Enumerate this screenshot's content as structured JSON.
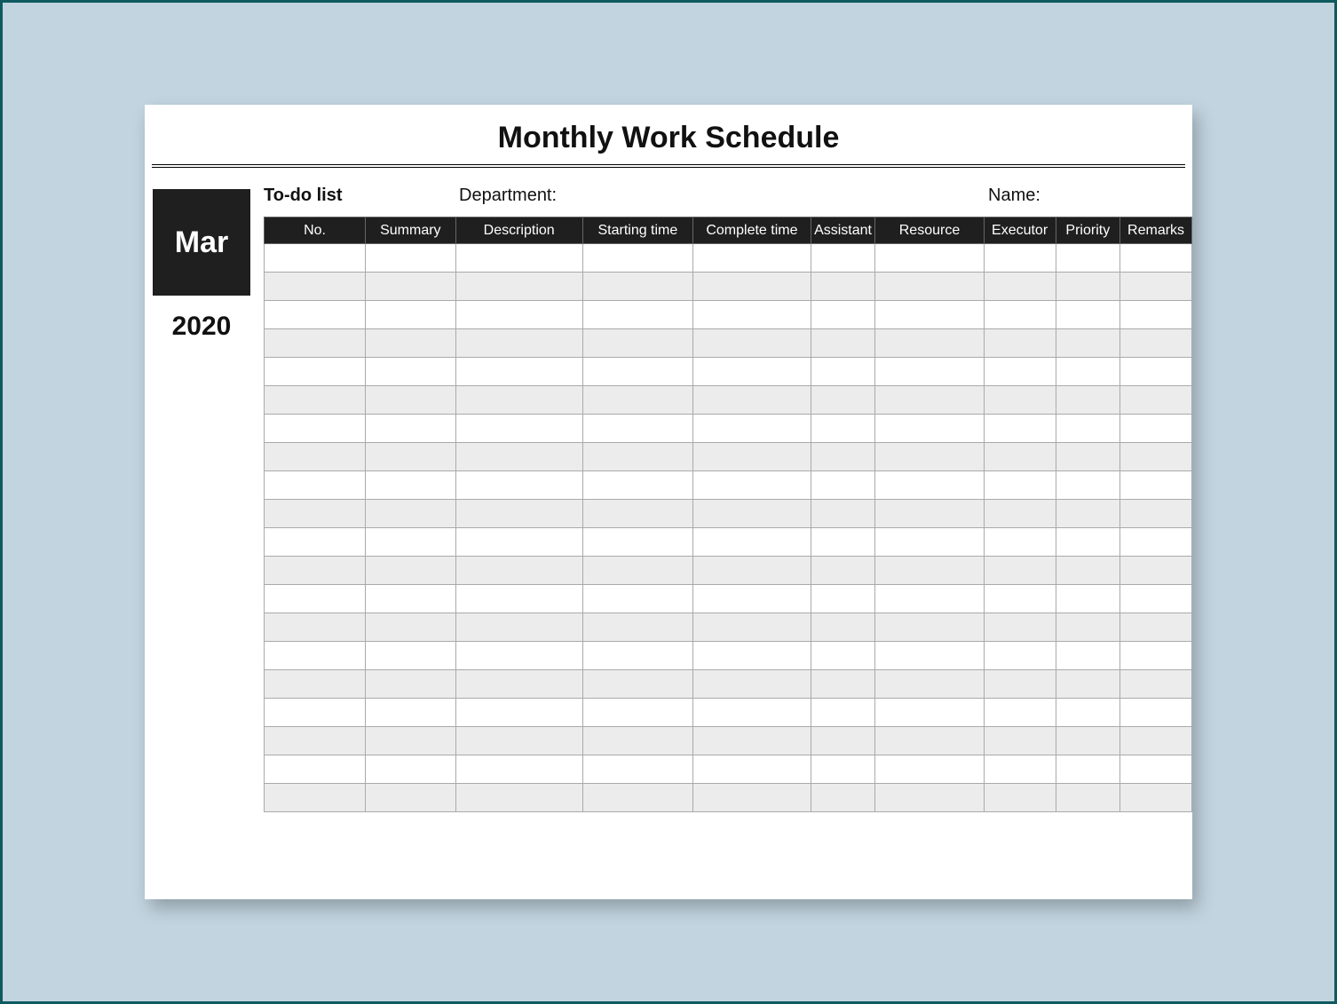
{
  "title": "Monthly Work Schedule",
  "sidebar": {
    "month": "Mar",
    "year": "2020"
  },
  "info": {
    "todo_label": "To-do list",
    "department_label": "Department:",
    "name_label": "Name:"
  },
  "columns": [
    "No.",
    "Summary",
    "Description",
    "Starting time",
    "Complete time",
    "Assistant",
    "Resource",
    "Executor",
    "Priority",
    "Remarks"
  ],
  "row_count": 20
}
